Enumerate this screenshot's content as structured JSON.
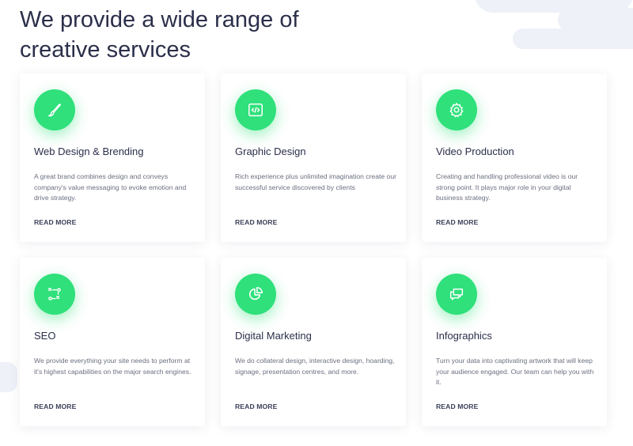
{
  "heading": "We provide a wide range of creative services",
  "accent_color": "#2fe07b",
  "cards": [
    {
      "icon": "brush-icon",
      "title": "Web Design & Brending",
      "description": "A great brand combines design and conveys company's value messaging to evoke emotion and drive strategy.",
      "link": "READ MORE"
    },
    {
      "icon": "code-icon",
      "title": "Graphic Design",
      "description": "Rich experience plus unlimited imagination create our successful service discovered by clients",
      "link": "READ MORE"
    },
    {
      "icon": "gear-icon",
      "title": "Video Production",
      "description": "Creating and handling professional video is our strong point. It plays major role in your digital business strategy.",
      "link": "READ MORE"
    },
    {
      "icon": "strategy-icon",
      "title": "SEO",
      "description": "We provide everything your site needs to perform at it's highest capabilities on the major search engines.",
      "link": "READ MORE"
    },
    {
      "icon": "pie-chart-icon",
      "title": "Digital Marketing",
      "description": "We do collateral design, interactive design, hoarding, signage, presentation centres, and more.",
      "link": "READ MORE"
    },
    {
      "icon": "chat-icon",
      "title": "Infographics",
      "description": "Turn your data into captivating artwork that will keep your audience engaged. Our team can help you with it.",
      "link": "READ MORE"
    }
  ]
}
